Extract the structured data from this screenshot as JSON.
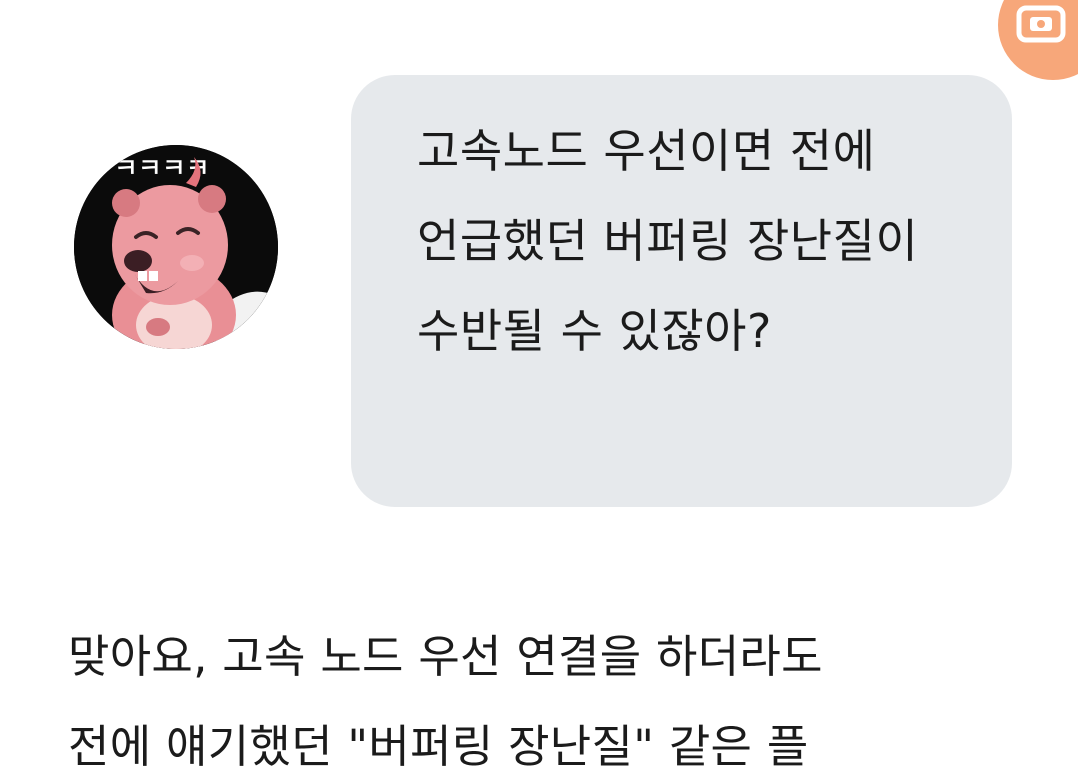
{
  "capture_button": {
    "icon": "camera-icon",
    "color": "#f7a77a"
  },
  "avatar": {
    "icon": "pink-beaver-character-avatar",
    "overlay_text": "ㅋㅋㅋㅋ"
  },
  "conversation": {
    "user_message": "고속노드 우선이면 전에 언급했던 버퍼링 장난질이 수반될 수 있잖아?",
    "assistant_message": "맞아요, 고속 노드 우선 연결을 하더라도\n전에 얘기했던 \"버퍼링 장난질\" 같은 플"
  },
  "colors": {
    "bubble_background": "#e6e9ec",
    "text": "#1b1b1b"
  }
}
